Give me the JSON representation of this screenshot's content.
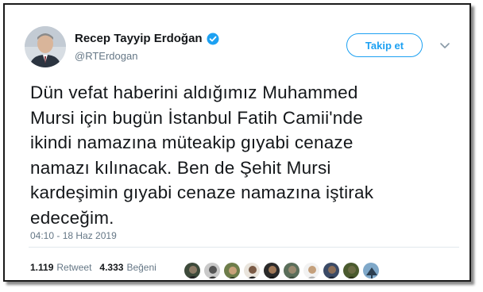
{
  "author": {
    "name": "Recep Tayyip Erdoğan",
    "handle": "@RTErdogan",
    "verified": true
  },
  "follow_button": {
    "label": "Takip et"
  },
  "tweet": {
    "lines": [
      "Dün vefat haberini aldığımız Muhammed",
      "Mursi için bugün İstanbul Fatih Camii'nde",
      "ikindi namazına müteakip gıyabi cenaze",
      "namazı kılınacak. Ben de Şehit Mursi",
      "kardeşimin gıyabi cenaze namazına iştirak",
      "edeceğim."
    ],
    "timestamp": "04:10 - 18 Haz 2019"
  },
  "stats": {
    "retweets_count": "1.119",
    "retweets_label": "Retweet",
    "likes_count": "4.333",
    "likes_label": "Beğeni"
  },
  "colors": {
    "accent": "#1da1f2",
    "text": "#14171a",
    "muted": "#657786"
  },
  "icons": {
    "verified": "verified-badge-icon",
    "caret": "chevron-down-icon"
  }
}
